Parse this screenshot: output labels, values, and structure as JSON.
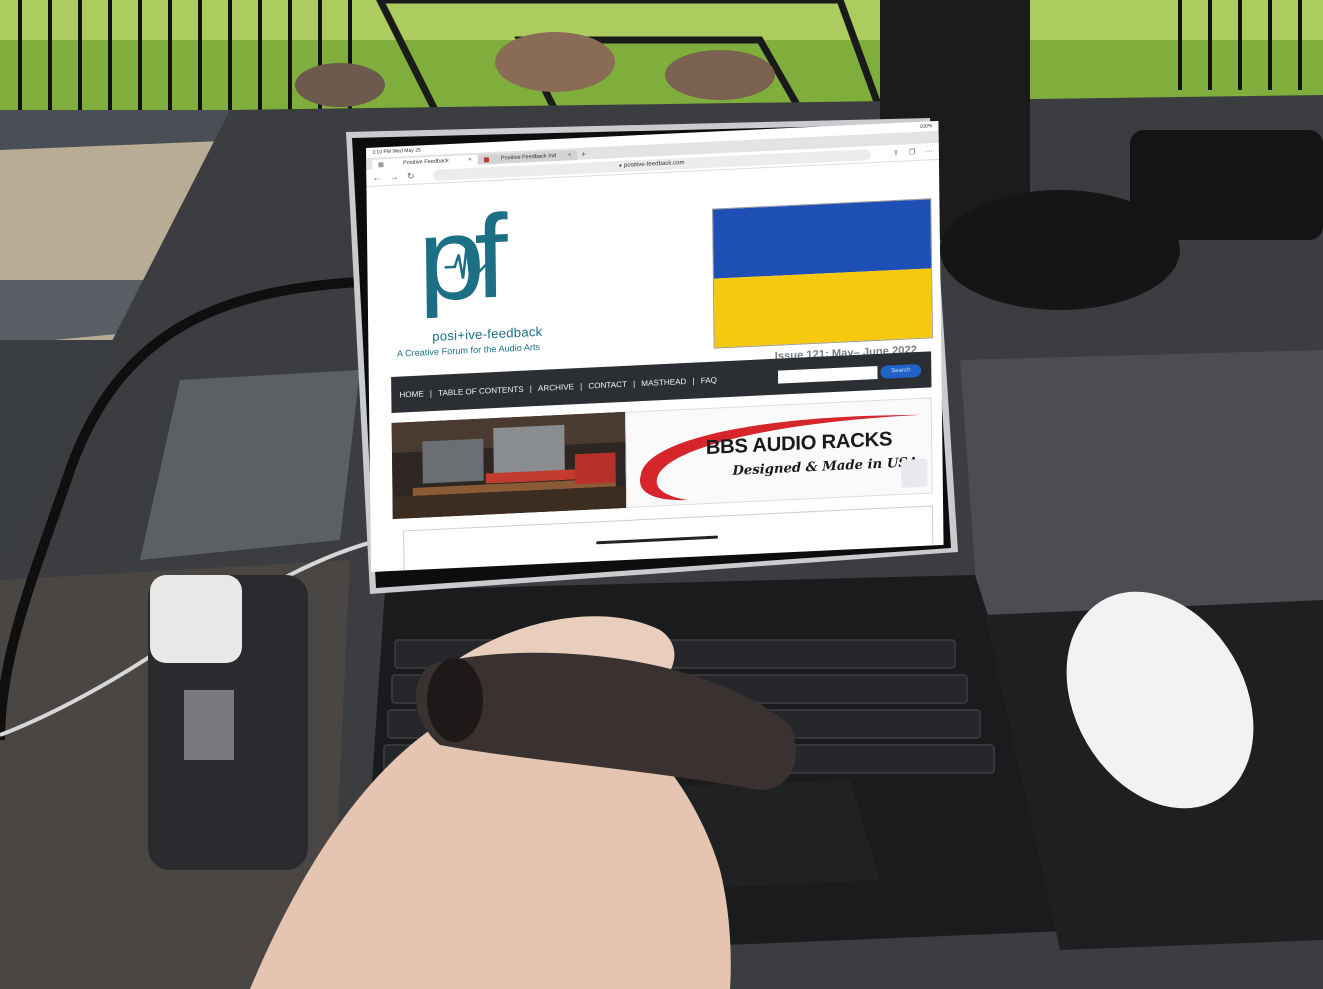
{
  "status_bar": {
    "time": "3:10 PM  Wed May 25",
    "battery": "100%"
  },
  "browser": {
    "tabs": [
      {
        "label": "Positive Feedback",
        "active": true
      },
      {
        "label": "Positive Feedback Ind",
        "active": false
      }
    ],
    "url": "positive-feedback.com"
  },
  "site": {
    "logo_letters": "pf",
    "logo_name": "posi+ive-feedback",
    "tagline": "A Creative Forum for the Audio Arts",
    "issue": "Issue 121: May– June 2022",
    "flag_colors": {
      "top": "#1d4fb5",
      "bottom": "#f6c90e"
    },
    "brand_color": "#1d6f86",
    "nav": [
      "HOME",
      "TABLE OF CONTENTS",
      "ARCHIVE",
      "CONTACT",
      "MASTHEAD",
      "FAQ"
    ],
    "search_button": "Search"
  },
  "ad": {
    "title": "BBS AUDIO RACKS",
    "subtitle": "Designed & Made in USA",
    "accent_color": "#d6262b"
  }
}
